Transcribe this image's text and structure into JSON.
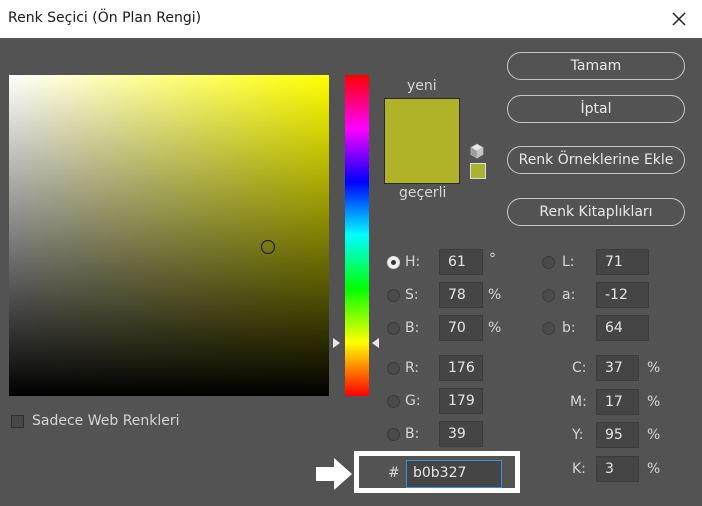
{
  "window": {
    "title": "Renk Seçici (Ön Plan Rengi)"
  },
  "preview": {
    "new_label": "yeni",
    "current_label": "geçerli",
    "new_color": "#b0b327",
    "web_safe_color": "#a8b331"
  },
  "buttons": {
    "ok": "Tamam",
    "cancel": "İptal",
    "add_to_swatches": "Renk Örneklerine Ekle",
    "color_libraries": "Renk Kitaplıkları"
  },
  "hsb": {
    "h": {
      "label": "H:",
      "value": "61",
      "unit": "°"
    },
    "s": {
      "label": "S:",
      "value": "78",
      "unit": "%"
    },
    "b": {
      "label": "B:",
      "value": "70",
      "unit": "%"
    }
  },
  "rgb": {
    "r": {
      "label": "R:",
      "value": "176"
    },
    "g": {
      "label": "G:",
      "value": "179"
    },
    "b": {
      "label": "B:",
      "value": "39"
    }
  },
  "lab": {
    "l": {
      "label": "L:",
      "value": "71"
    },
    "a": {
      "label": "a:",
      "value": "-12"
    },
    "b": {
      "label": "b:",
      "value": "64"
    }
  },
  "cmyk": {
    "c": {
      "label": "C:",
      "value": "37",
      "unit": "%"
    },
    "m": {
      "label": "M:",
      "value": "17",
      "unit": "%"
    },
    "y": {
      "label": "Y:",
      "value": "95",
      "unit": "%"
    },
    "k": {
      "label": "K:",
      "value": "3",
      "unit": "%"
    }
  },
  "hex": {
    "label": "#",
    "value": "b0b327"
  },
  "web_only": {
    "label": "Sadece Web Renkleri"
  }
}
